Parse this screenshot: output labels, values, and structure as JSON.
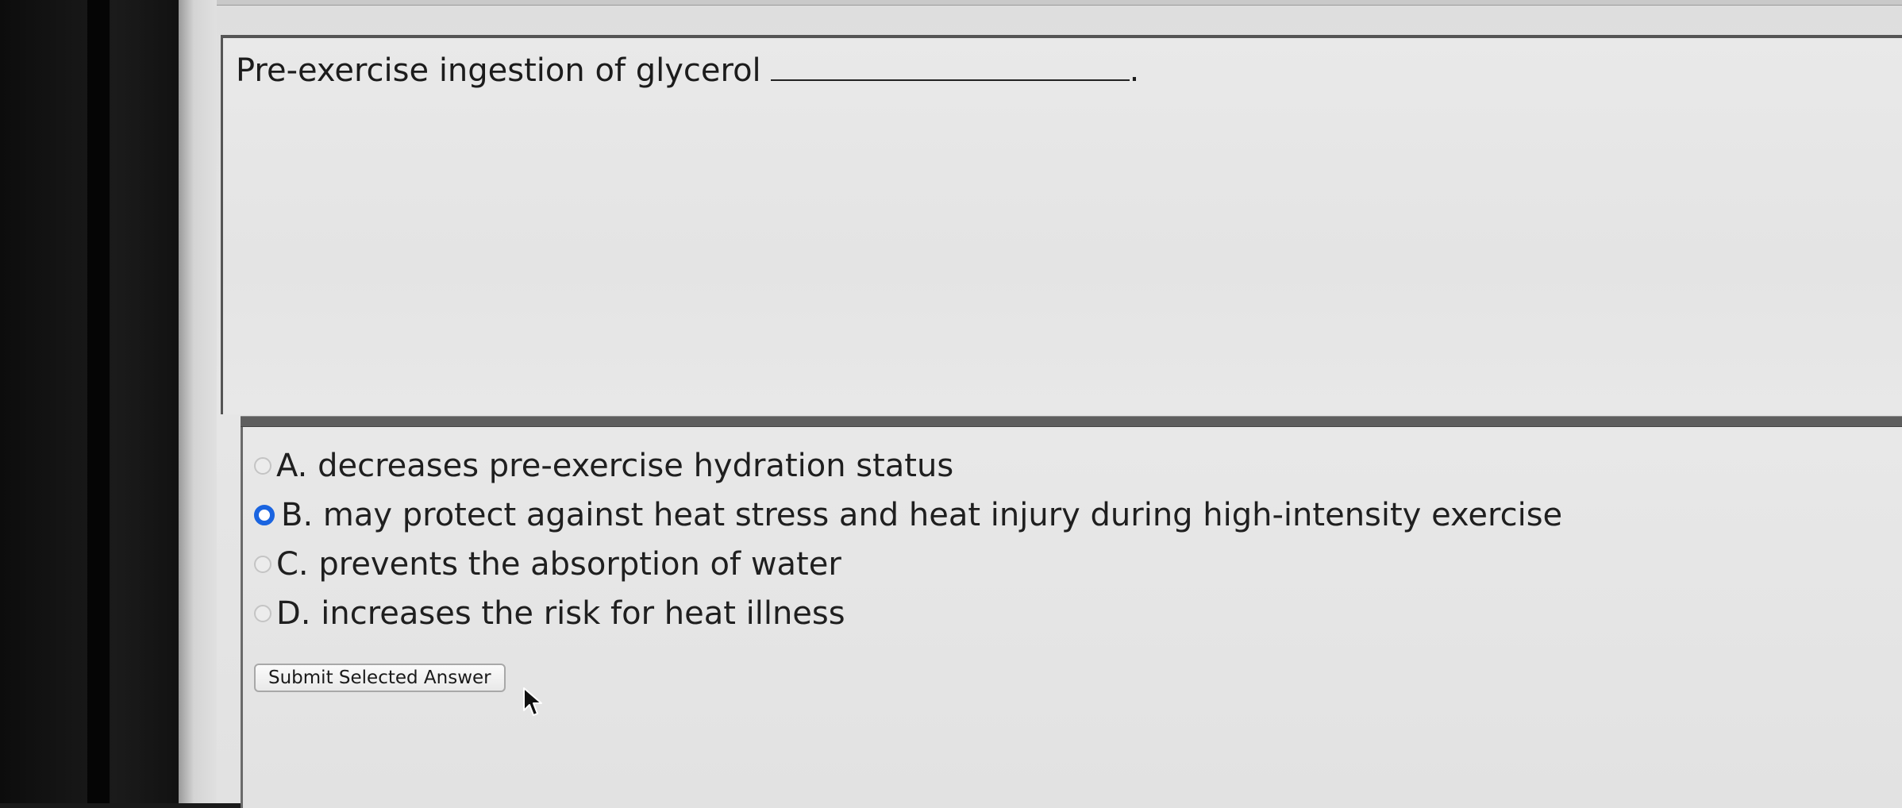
{
  "question": {
    "text": "Pre-exercise ingestion of glycerol",
    "terminal_punctuation": "."
  },
  "options": [
    {
      "label": "A. decreases pre-exercise hydration status",
      "selected": false
    },
    {
      "label": "B. may protect against heat stress and heat injury during high-intensity exercise",
      "selected": true
    },
    {
      "label": "C. prevents the absorption of water",
      "selected": false
    },
    {
      "label": "D. increases the risk for heat illness",
      "selected": false
    }
  ],
  "submit_button": {
    "label": "Submit Selected Answer"
  },
  "colors": {
    "radio_selected": "#1a64e0",
    "text": "#1c1c1c"
  },
  "icons": {
    "cursor": "mouse-pointer-arrow-icon"
  }
}
